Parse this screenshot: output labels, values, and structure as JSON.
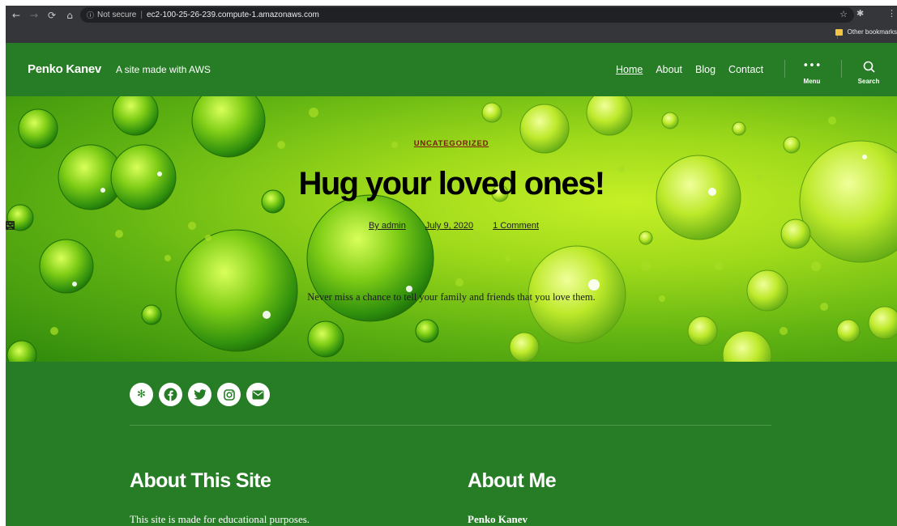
{
  "browser": {
    "nav_back_icon": "←",
    "nav_forward_icon": "→",
    "reload_icon": "⟳",
    "home_icon": "⌂",
    "security_label": "Not secure",
    "url": "ec2-100-25-26-239.compute-1.amazonaws.com",
    "other_bookmarks": "Other bookmarks"
  },
  "site": {
    "title": "Penko Kanev",
    "description": "A site made with AWS"
  },
  "nav": {
    "items": [
      {
        "label": "Home",
        "active": true
      },
      {
        "label": "About"
      },
      {
        "label": "Blog"
      },
      {
        "label": "Contact"
      }
    ],
    "menu_label": "Menu",
    "search_label": "Search"
  },
  "hero": {
    "category": "UNCATEGORIZED",
    "title": "Hug your loved ones!",
    "author": "By admin",
    "date": "July 9, 2020",
    "comments": "1 Comment",
    "excerpt": "Never miss a chance to tell your family and friends that you love them."
  },
  "footer": {
    "social": [
      "yelp-icon",
      "facebook-icon",
      "twitter-icon",
      "instagram-icon",
      "email-icon"
    ],
    "left_heading": "About This Site",
    "left_text": "This site is made for educational purposes.",
    "right_heading": "About Me",
    "right_text": "Penko Kanev"
  },
  "colors": {
    "brand_green": "#267d25",
    "category_red": "#cc1d2d",
    "chrome_dark": "#35363a"
  }
}
